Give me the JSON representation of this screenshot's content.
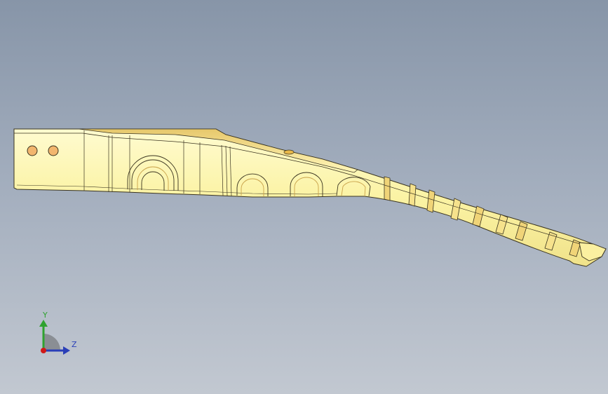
{
  "viewport": {
    "background_top": "#8795a8",
    "background_bottom": "#c2c8d1"
  },
  "model": {
    "fill_color": "#fbf4a8",
    "highlight_color": "#fff9c8",
    "edge_color": "#3a3420",
    "accent_color": "#e8b84a"
  },
  "triad": {
    "y_label": "Y",
    "z_label": "Z",
    "y_color": "#2fa22f",
    "z_color": "#2a3fb8",
    "x_color": "#d01818",
    "quadrant_color": "#8a8e94"
  }
}
